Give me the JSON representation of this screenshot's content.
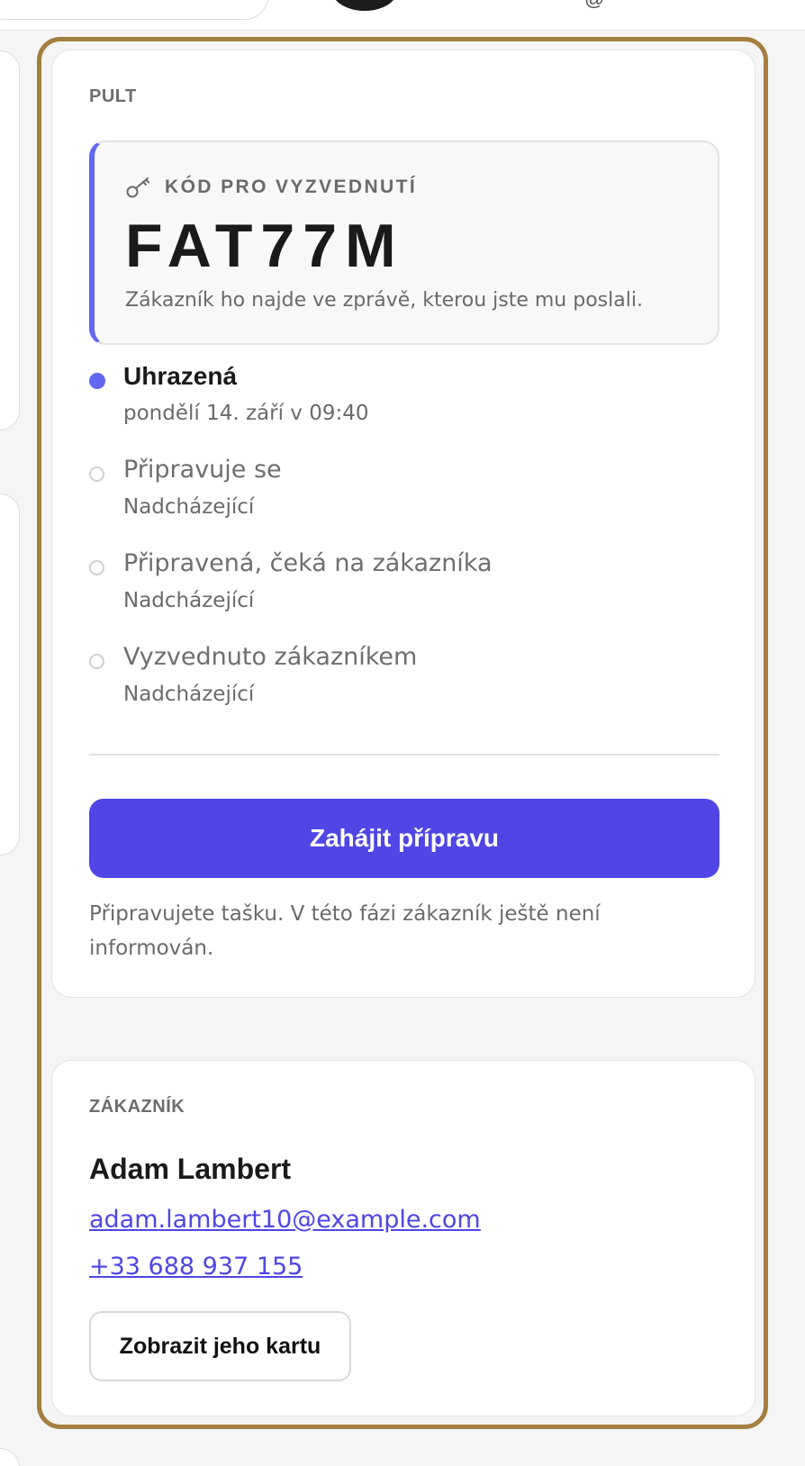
{
  "topbar": {
    "at_glyph": "@"
  },
  "pult": {
    "section_label": "PULT",
    "pickup": {
      "icon": "key-icon",
      "title": "KÓD PRO VYZVEDNUTÍ",
      "code": "FAT77M",
      "help": "Zákazník ho najde ve zprávě, kterou jste mu poslali."
    },
    "steps": [
      {
        "title": "Uhrazená",
        "sub": "pondělí 14. září v 09:40",
        "done": true
      },
      {
        "title": "Připravuje se",
        "sub": "Nadcházející",
        "done": false
      },
      {
        "title": "Připravená, čeká na zákazníka",
        "sub": "Nadcházející",
        "done": false
      },
      {
        "title": "Vyzvednuto zákazníkem",
        "sub": "Nadcházející",
        "done": false
      }
    ],
    "primary_action": "Zahájit přípravu",
    "hint": "Připravujete tašku. V této fázi zákazník ještě není informován."
  },
  "customer": {
    "section_label": "ZÁKAZNÍK",
    "name": "Adam Lambert",
    "email": "adam.lambert10@example.com",
    "phone": "+33 688 937 155",
    "profile_button": "Zobrazit jeho kartu"
  },
  "colors": {
    "accent": "#4f46e5",
    "step_done": "#6366f1",
    "focus_frame": "#a47f3f"
  }
}
